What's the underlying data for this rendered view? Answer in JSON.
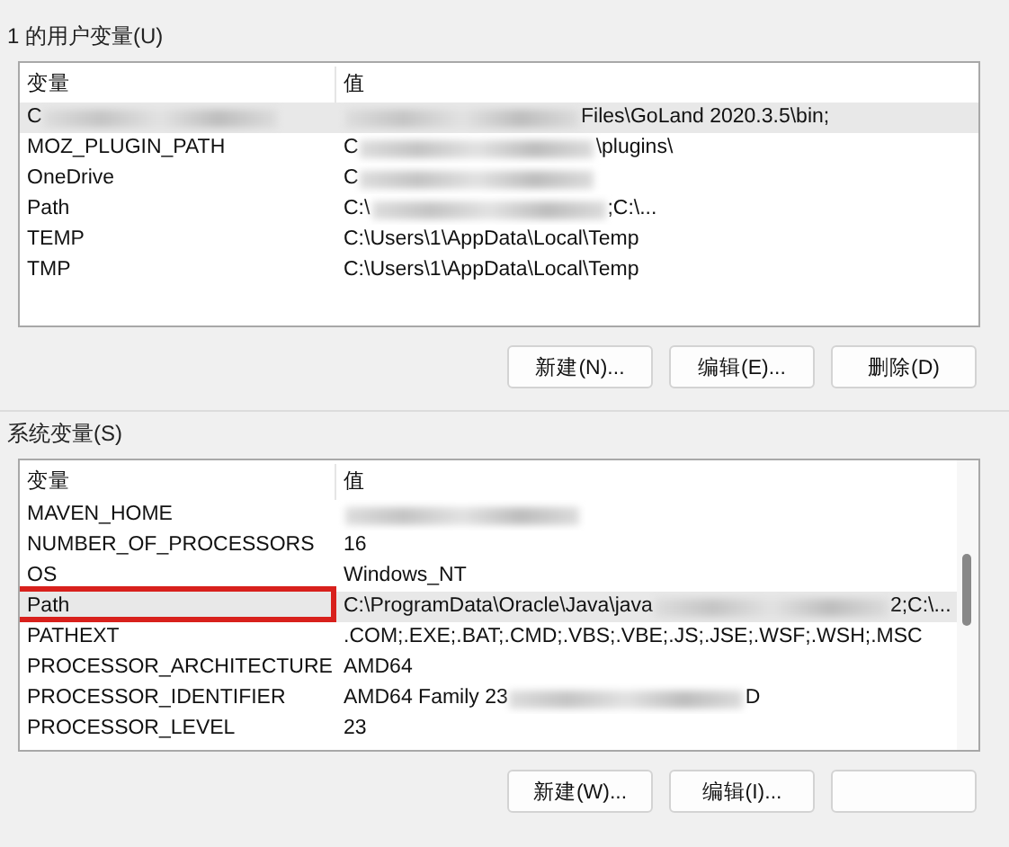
{
  "user_vars": {
    "title": "1 的用户变量(U)",
    "columns": [
      "变量",
      "值"
    ],
    "rows": [
      {
        "name": [
          {
            "text": "C"
          },
          {
            "kind": "blur"
          }
        ],
        "value": [
          {
            "kind": "blur"
          },
          {
            "text": "Files\\GoLand 2020.3.5\\bin;"
          }
        ],
        "selected": true,
        "highlighted": false
      },
      {
        "name": [
          {
            "text": "MOZ_PLUGIN_PATH"
          }
        ],
        "value": [
          {
            "text": "C"
          },
          {
            "kind": "blur"
          },
          {
            "text": "\\plugins\\"
          }
        ],
        "selected": false,
        "highlighted": false
      },
      {
        "name": [
          {
            "text": "OneDrive"
          }
        ],
        "value": [
          {
            "text": "C"
          },
          {
            "kind": "blur"
          }
        ],
        "selected": false,
        "highlighted": false
      },
      {
        "name": [
          {
            "text": "Path"
          }
        ],
        "value": [
          {
            "text": "C:\\"
          },
          {
            "kind": "blur"
          },
          {
            "text": ";C:\\..."
          }
        ],
        "selected": false,
        "highlighted": false
      },
      {
        "name": [
          {
            "text": "TEMP"
          }
        ],
        "value": [
          {
            "text": "C:\\Users\\1\\AppData\\Local\\Temp"
          }
        ],
        "selected": false,
        "highlighted": false
      },
      {
        "name": [
          {
            "text": "TMP"
          }
        ],
        "value": [
          {
            "text": "C:\\Users\\1\\AppData\\Local\\Temp"
          }
        ],
        "selected": false,
        "highlighted": false
      }
    ],
    "buttons": [
      {
        "label": "新建(N)..."
      },
      {
        "label": "编辑(E)..."
      },
      {
        "label": "删除(D)"
      }
    ]
  },
  "system_vars": {
    "title": "系统变量(S)",
    "columns": [
      "变量",
      "值"
    ],
    "rows": [
      {
        "name": [
          {
            "text": "MAVEN_HOME"
          }
        ],
        "value": [
          {
            "kind": "blur"
          }
        ],
        "selected": false,
        "highlighted": false
      },
      {
        "name": [
          {
            "text": "NUMBER_OF_PROCESSORS"
          }
        ],
        "value": [
          {
            "text": "16"
          }
        ],
        "selected": false,
        "highlighted": false
      },
      {
        "name": [
          {
            "text": "OS"
          }
        ],
        "value": [
          {
            "text": "Windows_NT"
          }
        ],
        "selected": false,
        "highlighted": false
      },
      {
        "name": [
          {
            "text": "Path"
          }
        ],
        "value": [
          {
            "text": "C:\\ProgramData\\Oracle\\Java\\java"
          },
          {
            "kind": "blur"
          },
          {
            "text": "2;C:\\..."
          }
        ],
        "selected": true,
        "highlighted": true
      },
      {
        "name": [
          {
            "text": "PATHEXT"
          }
        ],
        "value": [
          {
            "text": ".COM;.EXE;.BAT;.CMD;.VBS;.VBE;.JS;.JSE;.WSF;.WSH;.MSC"
          }
        ],
        "selected": false,
        "highlighted": false
      },
      {
        "name": [
          {
            "text": "PROCESSOR_ARCHITECTURE"
          }
        ],
        "value": [
          {
            "text": "AMD64"
          }
        ],
        "selected": false,
        "highlighted": false
      },
      {
        "name": [
          {
            "text": "PROCESSOR_IDENTIFIER"
          }
        ],
        "value": [
          {
            "text": "AMD64 Family 23"
          },
          {
            "kind": "blur"
          },
          {
            "text": "D"
          }
        ],
        "selected": false,
        "highlighted": false
      },
      {
        "name": [
          {
            "text": "PROCESSOR_LEVEL"
          }
        ],
        "value": [
          {
            "text": "23"
          }
        ],
        "selected": false,
        "highlighted": false
      }
    ],
    "buttons": [
      {
        "label": "新建(W)..."
      },
      {
        "label": "编辑(I)..."
      },
      {
        "kind": "covered"
      }
    ]
  }
}
